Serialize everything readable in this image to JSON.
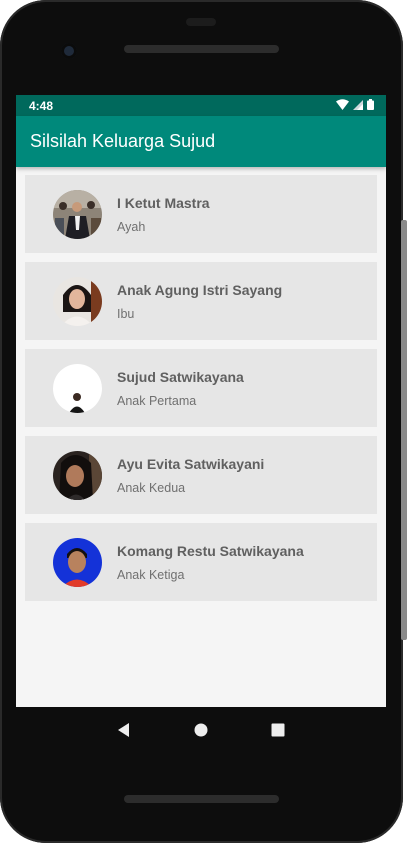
{
  "status_bar": {
    "time": "4:48"
  },
  "app_bar": {
    "title": "Silsilah Keluarga Sujud"
  },
  "members": [
    {
      "name": "I Ketut Mastra",
      "role": "Ayah"
    },
    {
      "name": "Anak Agung Istri Sayang",
      "role": "Ibu"
    },
    {
      "name": "Sujud Satwikayana",
      "role": "Anak Pertama"
    },
    {
      "name": "Ayu Evita Satwikayani",
      "role": "Anak Kedua"
    },
    {
      "name": "Komang Restu Satwikayana",
      "role": "Anak Ketiga"
    }
  ],
  "colors": {
    "status_bar": "#00695c",
    "app_bar": "#00897b",
    "card": "#e6e6e6",
    "screen_bg": "#f5f5f5"
  },
  "icons": {
    "status": [
      "wifi-icon",
      "signal-icon",
      "battery-icon"
    ],
    "nav": [
      "back-icon",
      "home-icon",
      "recents-icon"
    ]
  }
}
